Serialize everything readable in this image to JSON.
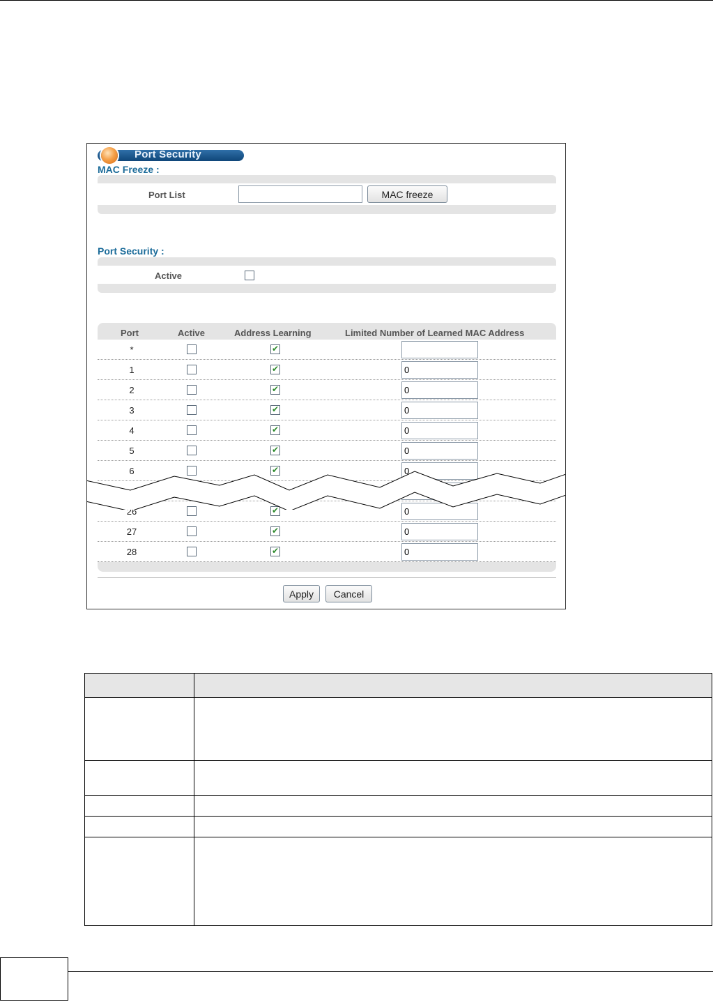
{
  "panel": {
    "title": "Port Security"
  },
  "mac_freeze": {
    "heading": "MAC Freeze :",
    "port_list_label": "Port List",
    "port_list_value": "",
    "button_label": "MAC freeze"
  },
  "port_security": {
    "heading": "Port Security :",
    "active_label": "Active",
    "active_checked": false
  },
  "table": {
    "headers": [
      "Port",
      "Active",
      "Address Learning",
      "Limited Number of Learned MAC Address"
    ],
    "rows": [
      {
        "port": "*",
        "active": false,
        "learning": true,
        "limit": ""
      },
      {
        "port": "1",
        "active": false,
        "learning": true,
        "limit": "0"
      },
      {
        "port": "2",
        "active": false,
        "learning": true,
        "limit": "0"
      },
      {
        "port": "3",
        "active": false,
        "learning": true,
        "limit": "0"
      },
      {
        "port": "4",
        "active": false,
        "learning": true,
        "limit": "0"
      },
      {
        "port": "5",
        "active": false,
        "learning": true,
        "limit": "0"
      },
      {
        "port": "6",
        "active": false,
        "learning": true,
        "limit": "0"
      },
      {
        "port": "26",
        "active": false,
        "learning": true,
        "limit": "0"
      },
      {
        "port": "27",
        "active": false,
        "learning": true,
        "limit": "0"
      },
      {
        "port": "28",
        "active": false,
        "learning": true,
        "limit": "0"
      }
    ]
  },
  "actions": {
    "apply_label": "Apply",
    "cancel_label": "Cancel"
  }
}
